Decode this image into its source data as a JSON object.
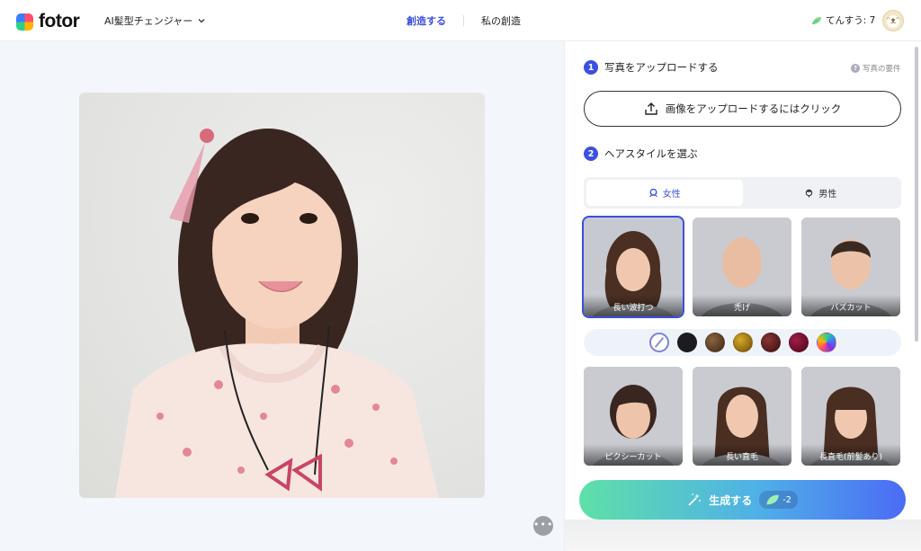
{
  "header": {
    "logo_text": "fotor",
    "tool_menu_label": "AI髪型チェンジャー",
    "nav_create": "創造する",
    "nav_my_creations": "私の創造",
    "credits_label": "てんすう: 7"
  },
  "canvas": {
    "more_button": "•••"
  },
  "panel": {
    "step1": {
      "number": "1",
      "label": "写真をアップロードする",
      "requirements": "写真の要件"
    },
    "upload_button": "画像をアップロードするにはクリック",
    "step2": {
      "number": "2",
      "label": "ヘアスタイルを選ぶ"
    },
    "gender_tabs": [
      {
        "label": "女性",
        "active": true
      },
      {
        "label": "男性",
        "active": false
      }
    ],
    "styles_row1": [
      {
        "label": "長い波打つ",
        "selected": true
      },
      {
        "label": "禿げ",
        "selected": false
      },
      {
        "label": "バズカット",
        "selected": false
      }
    ],
    "hair_colors": [
      {
        "name": "none",
        "color": "#ffffff"
      },
      {
        "name": "black",
        "color": "#1c1c1e"
      },
      {
        "name": "brown",
        "color": "#5a3d22"
      },
      {
        "name": "gold",
        "color": "#a67c12"
      },
      {
        "name": "dark-red",
        "color": "#5e1e1e"
      },
      {
        "name": "burgundy",
        "color": "#6c0f2c"
      },
      {
        "name": "rainbow",
        "color": "#4b6bf5"
      }
    ],
    "styles_row2": [
      {
        "label": "ピクシーカット",
        "selected": false
      },
      {
        "label": "長い直毛",
        "selected": false
      },
      {
        "label": "長直毛(前髪あり)",
        "selected": false
      }
    ],
    "generate_button": "生成する",
    "generate_cost": "-2"
  },
  "colors": {
    "accent": "#3b4fe0",
    "generate_start": "#5ee0a8",
    "generate_end": "#4b6bf5"
  }
}
